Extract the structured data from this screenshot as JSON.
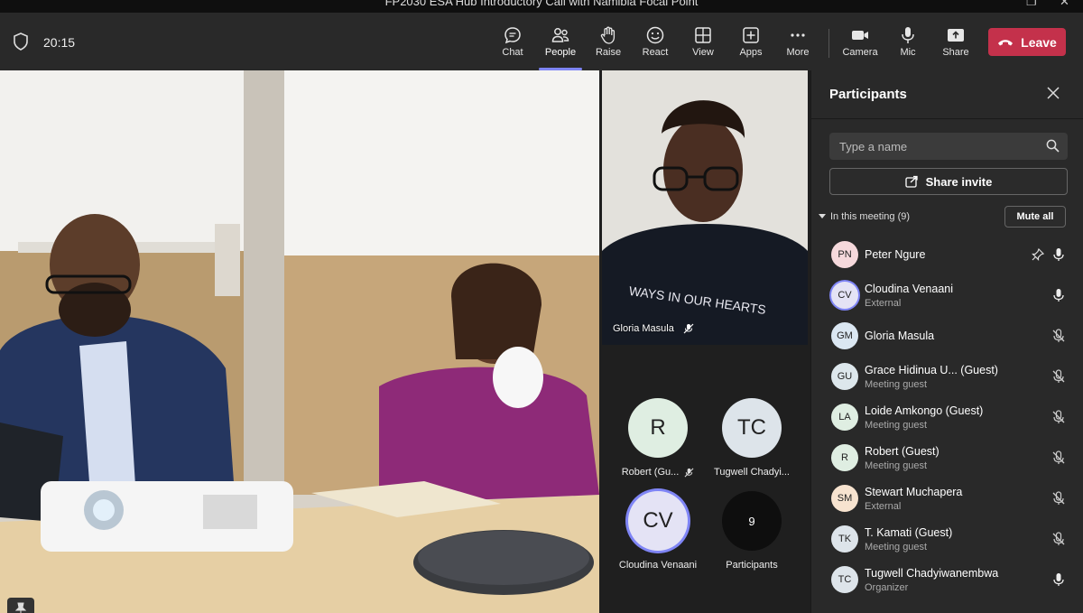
{
  "window": {
    "title": "FP2030 ESA Hub Introductory Call with Namibia Focal Point"
  },
  "toolbar": {
    "time": "20:15",
    "buttons": [
      {
        "label": "Chat",
        "icon": "chat-icon"
      },
      {
        "label": "People",
        "icon": "people-icon",
        "active": true
      },
      {
        "label": "Raise",
        "icon": "raise-hand-icon"
      },
      {
        "label": "React",
        "icon": "react-icon"
      },
      {
        "label": "View",
        "icon": "view-icon"
      },
      {
        "label": "Apps",
        "icon": "apps-icon"
      },
      {
        "label": "More",
        "icon": "more-icon"
      },
      {
        "label": "Camera",
        "icon": "camera-icon"
      },
      {
        "label": "Mic",
        "icon": "mic-icon"
      },
      {
        "label": "Share",
        "icon": "share-icon"
      }
    ],
    "leave_label": "Leave"
  },
  "stage": {
    "pinned_video_name": "Gloria Masula",
    "tiles": [
      {
        "initials": "R",
        "name": "Robert (Gu...",
        "color": "#dfeee2",
        "muted": true
      },
      {
        "initials": "TC",
        "name": "Tugwell Chadyi...",
        "color": "#dde4ea",
        "muted": false
      },
      {
        "initials": "CV",
        "name": "Cloudina Venaani",
        "color": "#e4e3f5",
        "muted": false
      },
      {
        "initials": "9",
        "name": "Participants",
        "color": "#0e0e0e",
        "muted": false
      }
    ]
  },
  "panel": {
    "title": "Participants",
    "search_placeholder": "Type a name",
    "share_invite": "Share invite",
    "section_label": "In this meeting (9)",
    "mute_all": "Mute all",
    "participants": [
      {
        "initials": "PN",
        "name": "Peter Ngure",
        "role": "",
        "color": "#f6d9dc",
        "mic": "on",
        "pinned": true
      },
      {
        "initials": "CV",
        "name": "Cloudina Venaani",
        "role": "External",
        "color": "#e4e3f5",
        "mic": "on",
        "speaking": true
      },
      {
        "initials": "GM",
        "name": "Gloria Masula",
        "role": "",
        "color": "#dbe7f2",
        "mic": "off"
      },
      {
        "initials": "GU",
        "name": "Grace Hidinua U...  (Guest)",
        "role": "Meeting guest",
        "color": "#dde7ec",
        "mic": "off"
      },
      {
        "initials": "LA",
        "name": "Loide Amkongo (Guest)",
        "role": "Meeting guest",
        "color": "#dfeee2",
        "mic": "off"
      },
      {
        "initials": "R",
        "name": "Robert (Guest)",
        "role": "Meeting guest",
        "color": "#dfeee2",
        "mic": "off"
      },
      {
        "initials": "SM",
        "name": "Stewart Muchapera",
        "role": "External",
        "color": "#f7e3cf",
        "mic": "off"
      },
      {
        "initials": "TK",
        "name": "T. Kamati (Guest)",
        "role": "Meeting guest",
        "color": "#dde4ea",
        "mic": "off"
      },
      {
        "initials": "TC",
        "name": "Tugwell Chadyiwanembwa",
        "role": "Organizer",
        "color": "#dde4ea",
        "mic": "on"
      }
    ]
  }
}
